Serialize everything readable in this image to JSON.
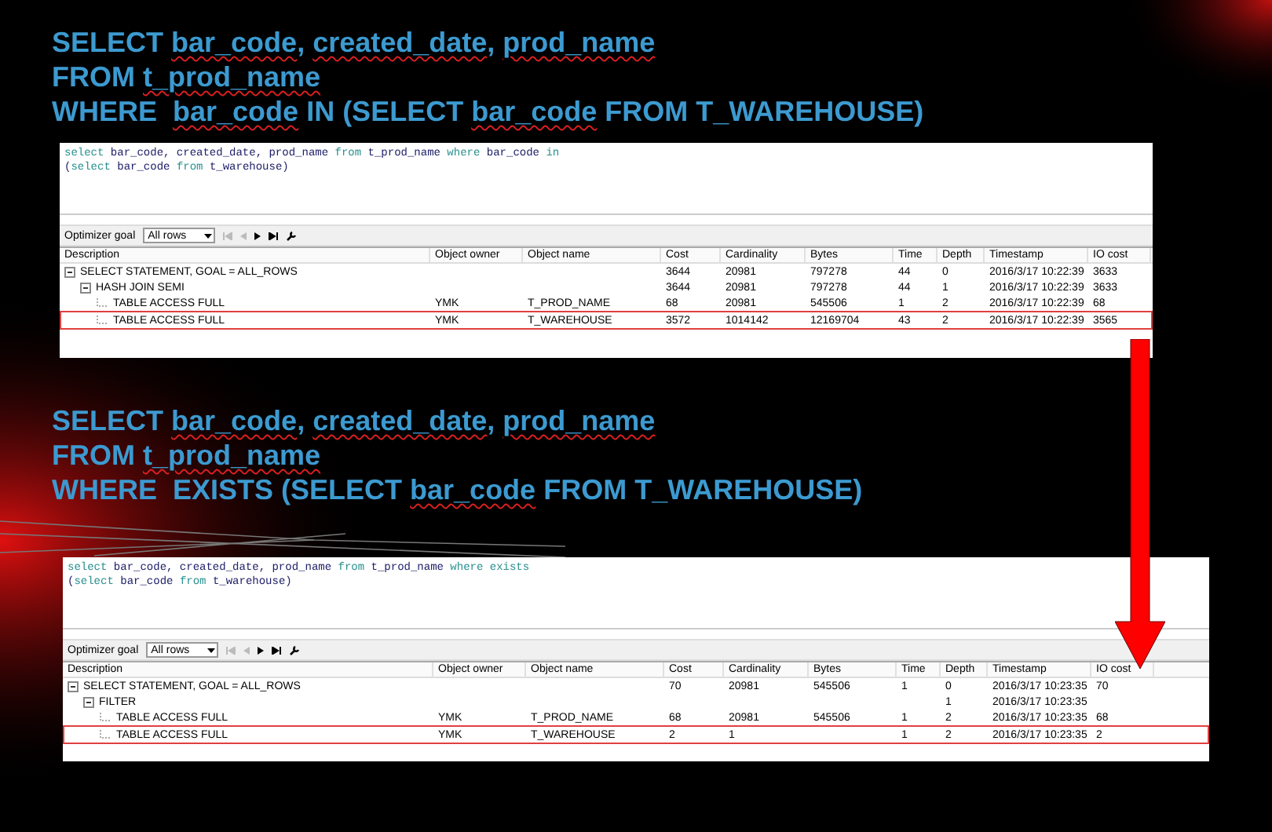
{
  "slides": [
    {
      "heading_lines": [
        [
          {
            "text": "SELECT "
          },
          {
            "text": "bar_code",
            "misspelled": true
          },
          {
            "text": ", "
          },
          {
            "text": "created_date",
            "misspelled": true
          },
          {
            "text": ", "
          },
          {
            "text": "prod_name",
            "misspelled": true
          }
        ],
        [
          {
            "text": "FROM "
          },
          {
            "text": "t_prod_name",
            "misspelled": true
          }
        ],
        [
          {
            "text": "WHERE  "
          },
          {
            "text": "bar_code",
            "misspelled": true
          },
          {
            "text": " IN (SELECT "
          },
          {
            "text": "bar_code",
            "misspelled": true
          },
          {
            "text": " FROM T_WAREHOUSE)"
          }
        ]
      ],
      "panel": {
        "sql_lines": [
          [
            {
              "kind": "keyword",
              "text": "select"
            },
            {
              "kind": "text",
              "text": " bar_code, created_date, prod_name "
            },
            {
              "kind": "keyword",
              "text": "from"
            },
            {
              "kind": "text",
              "text": " t_prod_name "
            },
            {
              "kind": "keyword",
              "text": "where"
            },
            {
              "kind": "text",
              "text": " bar_code "
            },
            {
              "kind": "keyword",
              "text": "in"
            }
          ],
          [
            {
              "kind": "text",
              "text": "("
            },
            {
              "kind": "keyword",
              "text": "select"
            },
            {
              "kind": "text",
              "text": " bar_code "
            },
            {
              "kind": "keyword",
              "text": "from"
            },
            {
              "kind": "text",
              "text": " t_warehouse)"
            }
          ]
        ],
        "optimizer_label": "Optimizer goal",
        "optimizer_value": "All rows",
        "columns": [
          "Description",
          "Object owner",
          "Object name",
          "Cost",
          "Cardinality",
          "Bytes",
          "Time",
          "Depth",
          "Timestamp",
          "IO cost"
        ],
        "rows": [
          {
            "description": "SELECT STATEMENT, GOAL = ALL_ROWS",
            "cost": "3644",
            "cardinality": "20981",
            "bytes": "797278",
            "time": "44",
            "depth": "0",
            "timestamp": "2016/3/17 10:22:39",
            "io_cost": "3633",
            "highlighted": false,
            "expanded": true,
            "children": [
              {
                "description": "HASH JOIN SEMI",
                "cost": "3644",
                "cardinality": "20981",
                "bytes": "797278",
                "time": "44",
                "depth": "1",
                "timestamp": "2016/3/17 10:22:39",
                "io_cost": "3633",
                "highlighted": false,
                "expanded": true,
                "children": [
                  {
                    "description": "TABLE ACCESS FULL",
                    "owner": "YMK",
                    "object_name": "T_PROD_NAME",
                    "cost": "68",
                    "cardinality": "20981",
                    "bytes": "545506",
                    "time": "1",
                    "depth": "2",
                    "timestamp": "2016/3/17 10:22:39",
                    "io_cost": "68",
                    "highlighted": false
                  },
                  {
                    "description": "TABLE ACCESS FULL",
                    "owner": "YMK",
                    "object_name": "T_WAREHOUSE",
                    "cost": "3572",
                    "cardinality": "1014142",
                    "bytes": "12169704",
                    "time": "43",
                    "depth": "2",
                    "timestamp": "2016/3/17 10:22:39",
                    "io_cost": "3565",
                    "highlighted": true
                  }
                ]
              }
            ]
          }
        ]
      }
    },
    {
      "heading_lines": [
        [
          {
            "text": "SELECT "
          },
          {
            "text": "bar_code",
            "misspelled": true
          },
          {
            "text": ", "
          },
          {
            "text": "created_date",
            "misspelled": true
          },
          {
            "text": ", "
          },
          {
            "text": "prod_name",
            "misspelled": true
          }
        ],
        [
          {
            "text": "FROM "
          },
          {
            "text": "t_prod_name",
            "misspelled": true
          }
        ],
        [
          {
            "text": "WHERE  EXISTS (SELECT "
          },
          {
            "text": "bar_code",
            "misspelled": true
          },
          {
            "text": " FROM T_WAREHOUSE)"
          }
        ]
      ],
      "panel": {
        "sql_lines": [
          [
            {
              "kind": "keyword",
              "text": "select"
            },
            {
              "kind": "text",
              "text": " bar_code, created_date, prod_name "
            },
            {
              "kind": "keyword",
              "text": "from"
            },
            {
              "kind": "text",
              "text": " t_prod_name "
            },
            {
              "kind": "keyword",
              "text": "where exists"
            }
          ],
          [
            {
              "kind": "text",
              "text": "("
            },
            {
              "kind": "keyword",
              "text": "select"
            },
            {
              "kind": "text",
              "text": " bar_code "
            },
            {
              "kind": "keyword",
              "text": "from"
            },
            {
              "kind": "text",
              "text": " t_warehouse)"
            }
          ]
        ],
        "optimizer_label": "Optimizer goal",
        "optimizer_value": "All rows",
        "columns": [
          "Description",
          "Object owner",
          "Object name",
          "Cost",
          "Cardinality",
          "Bytes",
          "Time",
          "Depth",
          "Timestamp",
          "IO cost"
        ],
        "rows": [
          {
            "description": "SELECT STATEMENT, GOAL = ALL_ROWS",
            "cost": "70",
            "cardinality": "20981",
            "bytes": "545506",
            "time": "1",
            "depth": "0",
            "timestamp": "2016/3/17 10:23:35",
            "io_cost": "70",
            "highlighted": false,
            "expanded": true,
            "children": [
              {
                "description": "FILTER",
                "depth": "1",
                "timestamp": "2016/3/17 10:23:35",
                "highlighted": false,
                "expanded": true,
                "children": [
                  {
                    "description": "TABLE ACCESS FULL",
                    "owner": "YMK",
                    "object_name": "T_PROD_NAME",
                    "cost": "68",
                    "cardinality": "20981",
                    "bytes": "545506",
                    "time": "1",
                    "depth": "2",
                    "timestamp": "2016/3/17 10:23:35",
                    "io_cost": "68",
                    "highlighted": false
                  },
                  {
                    "description": "TABLE ACCESS FULL",
                    "owner": "YMK",
                    "object_name": "T_WAREHOUSE",
                    "cost": "2",
                    "cardinality": "1",
                    "time": "1",
                    "depth": "2",
                    "timestamp": "2016/3/17 10:23:35",
                    "io_cost": "2",
                    "highlighted": true
                  }
                ]
              }
            ]
          }
        ]
      }
    }
  ]
}
